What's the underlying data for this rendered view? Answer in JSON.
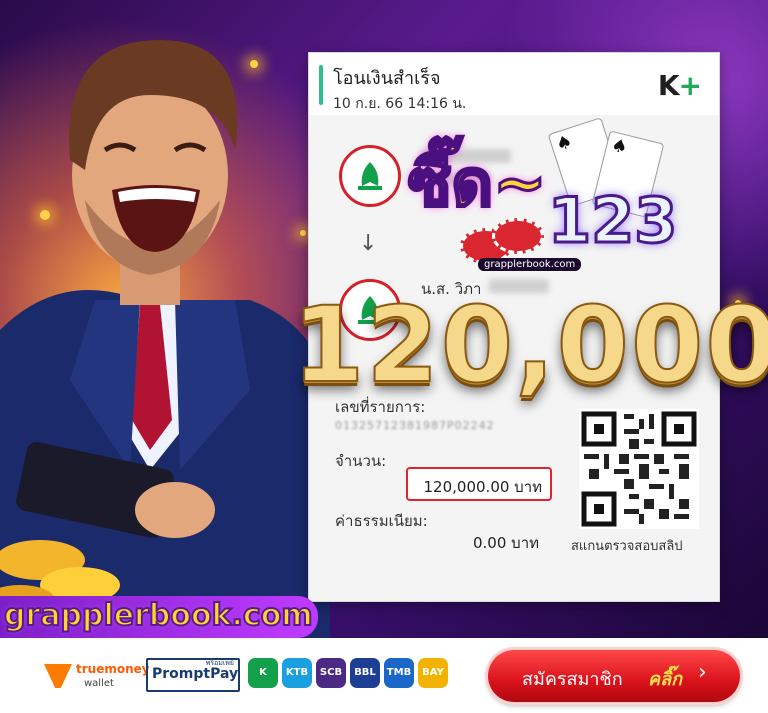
{
  "receipt": {
    "title": "โอนเงินสำเร็จ",
    "datetime": "10 ก.ย. 66  14:16 น.",
    "logo": "K+",
    "recipient_name": "น.ส. วิภา",
    "ref_label": "เลขที่รายการ:",
    "ref_value": "01325712381987P02242",
    "amount_label": "จำนวน:",
    "amount_value": "120,000.00 บาท",
    "fee_label": "ค่าธรรมเนียม:",
    "fee_value": "0.00 บาท",
    "qr_caption": "สแกนตรวจสอบสลิป",
    "arrow": "↓"
  },
  "badge": {
    "word": "ซี๊ด~",
    "number": "123",
    "url": "grapplerbook.com"
  },
  "headline": {
    "amount": "120,000"
  },
  "site": {
    "name": "grapplerbook.com"
  },
  "footer": {
    "truemoney_name": "truemoney",
    "truemoney_sub": "wallet",
    "promptpay_small": "พร้อมเพย์",
    "promptpay_name": "PromptPay",
    "bank_icons": [
      {
        "name": "kbank-icon",
        "color": "#12a04a",
        "text": "K"
      },
      {
        "name": "krungthai-icon",
        "color": "#1a9fe0",
        "text": "KTB"
      },
      {
        "name": "scb-icon",
        "color": "#4b2a86",
        "text": "SCB"
      },
      {
        "name": "bbl-icon",
        "color": "#1c3f94",
        "text": "BBL"
      },
      {
        "name": "tmb-icon",
        "color": "#1a66c9",
        "text": "TMB"
      },
      {
        "name": "krungsri-icon",
        "color": "#f2b300",
        "text": "BAY"
      }
    ],
    "cta_text": "สมัครสมาชิก",
    "cta_accent": "คลิ๊ก",
    "cta_arrow": "›"
  }
}
